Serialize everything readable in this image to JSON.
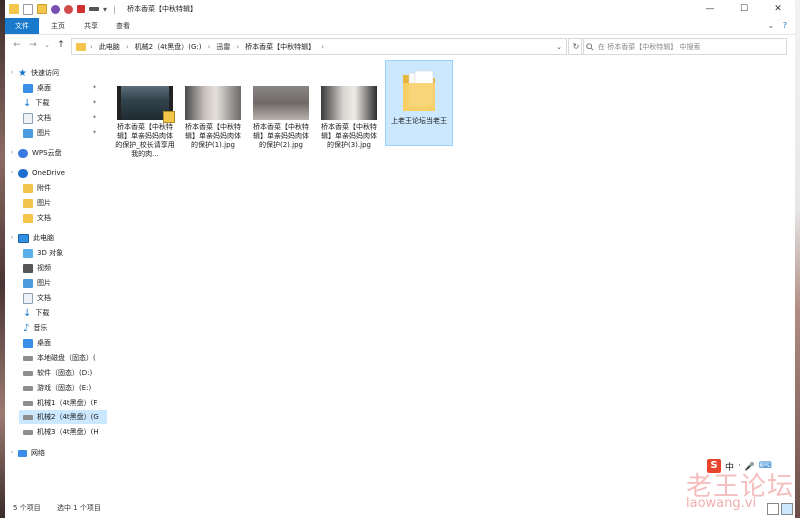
{
  "window": {
    "title": "桥本香菜【中秋特辑】",
    "controls": {
      "minimize": "—",
      "maximize": "☐",
      "close": "✕"
    }
  },
  "ribbon": {
    "tabs": [
      "文件",
      "主页",
      "共享",
      "查看"
    ],
    "expand": "⌄",
    "help": "?"
  },
  "address": {
    "back": "←",
    "forward": "→",
    "recent": "⌄",
    "up": "↑",
    "crumbs": [
      "此电脑",
      "机械2（4t黑盘）(G:)",
      "迅雷",
      "桥本香菜【中秋特辑】"
    ],
    "separator": "›",
    "dropdown": "⌄",
    "refresh": "↻",
    "search_placeholder": "在 桥本香菜【中秋特辑】 中搜索"
  },
  "nav": {
    "quick_access": "快速访问",
    "quick_items": [
      "桌面",
      "下载",
      "文档",
      "图片"
    ],
    "wps": "WPS云盘",
    "onedrive": "OneDrive",
    "onedrive_items": [
      "附件",
      "图片",
      "文档"
    ],
    "this_pc": "此电脑",
    "pc_items": [
      "3D 对象",
      "视频",
      "图片",
      "文档",
      "下载",
      "音乐",
      "桌面"
    ],
    "drives": [
      "本地磁盘（固态）(",
      "软件（固态）(D:)",
      "游戏（固态）(E:)",
      "机械1（4t黑盘）(F",
      "机械2（4t黑盘）(G",
      "机械3（4t黑盘）(H"
    ],
    "network": "网络"
  },
  "files": [
    {
      "name": "桥本香菜【中秋特辑】单亲妈妈肉体的保护_校长请享用我的肉...",
      "kind": "video"
    },
    {
      "name": "桥本香菜【中秋特辑】单亲妈妈肉体的保护(1).jpg",
      "kind": "image"
    },
    {
      "name": "桥本香菜【中秋特辑】单亲妈妈肉体的保护(2).jpg",
      "kind": "image"
    },
    {
      "name": "桥本香菜【中秋特辑】单亲妈妈肉体的保护(3).jpg",
      "kind": "image"
    },
    {
      "name": "上老王论坛当老王",
      "kind": "folder"
    }
  ],
  "status": {
    "item_count": "5 个项目",
    "selected": "选中 1 个项目"
  },
  "ime": {
    "logo": "S",
    "mode": "中",
    "punct": "·",
    "mic": "🎤",
    "keyboard": "⌨"
  },
  "watermark": {
    "cn": "老王论坛",
    "en": "laowang.vi"
  },
  "colors": {
    "accent": "#1979ca",
    "selection": "#cce8ff",
    "folder": "#f3c54b"
  }
}
